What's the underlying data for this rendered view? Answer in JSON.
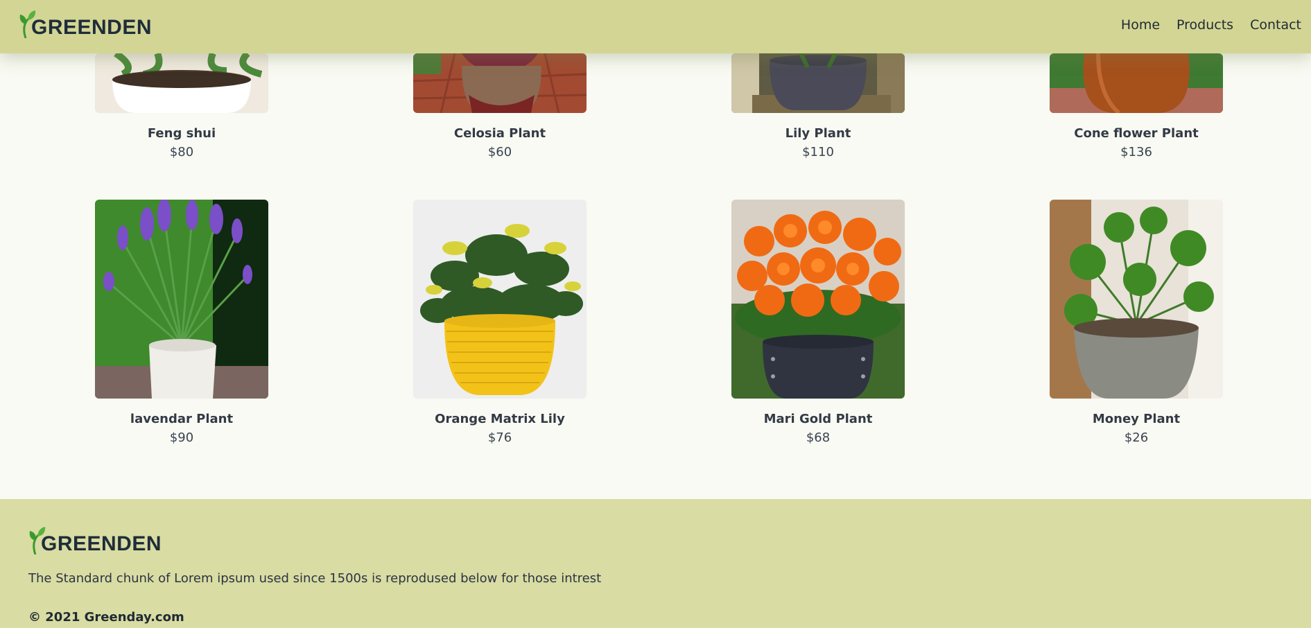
{
  "brand": {
    "name": "GREENDEN"
  },
  "nav": {
    "items": [
      "Home",
      "Products",
      "Contact"
    ]
  },
  "products": {
    "row1": [
      {
        "name": "Feng shui",
        "price": "$80"
      },
      {
        "name": "Celosia Plant",
        "price": "$60"
      },
      {
        "name": "Lily Plant",
        "price": "$110"
      },
      {
        "name": "Cone flower Plant",
        "price": "$136"
      }
    ],
    "row2": [
      {
        "name": "lavendar Plant",
        "price": "$90"
      },
      {
        "name": "Orange Matrix Lily",
        "price": "$76"
      },
      {
        "name": "Mari Gold Plant",
        "price": "$68"
      },
      {
        "name": "Money Plant",
        "price": "$26"
      }
    ]
  },
  "footer": {
    "brand": "GREENDEN",
    "text": "The Standard chunk of Lorem ipsum used since 1500s is reprodused below for those intrest",
    "copyright": "© 2021 Greenday.com"
  },
  "colors": {
    "header_bg": "#d3d594",
    "footer_bg": "#d9dca3",
    "page_bg": "#f8faf3",
    "leaf_green": "#3a9a2f"
  },
  "icons": {
    "logo": "leaf-icon"
  }
}
